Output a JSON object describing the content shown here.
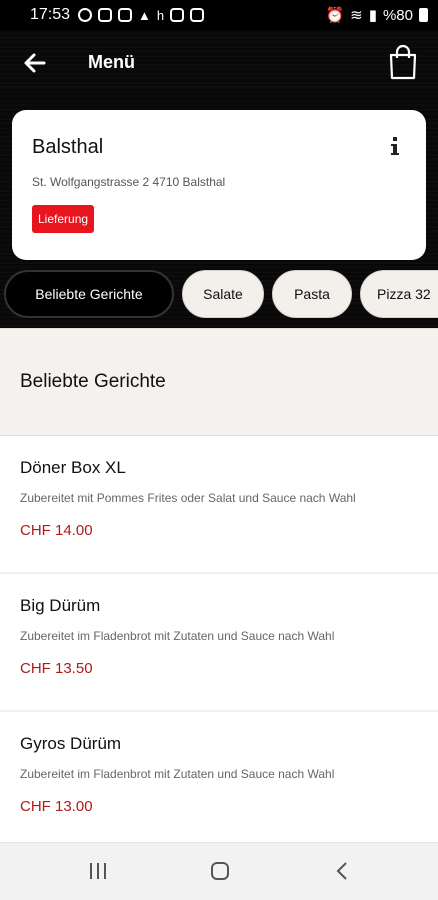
{
  "status_bar": {
    "time": "17:53",
    "left_icons": [
      "whatsapp-icon",
      "instagram-icon",
      "package-icon",
      "ship-icon",
      "h-icon",
      "instagram-icon",
      "image-icon"
    ],
    "h_label": "h",
    "battery": "%80"
  },
  "header": {
    "title": "Menü"
  },
  "location": {
    "name": "Balsthal",
    "address": "St. Wolfgangstrasse 2 4710 Balsthal",
    "badge": "Lieferung"
  },
  "categories": [
    {
      "label": "Beliebte Gerichte",
      "active": true
    },
    {
      "label": "Salate",
      "active": false
    },
    {
      "label": "Pasta",
      "active": false
    },
    {
      "label": "Pizza 32",
      "active": false
    }
  ],
  "section": {
    "title": "Beliebte Gerichte"
  },
  "items": [
    {
      "name": "Döner Box XL",
      "description": "Zubereitet mit Pommes Frites oder Salat und Sauce nach Wahl",
      "price": "CHF 14.00"
    },
    {
      "name": "Big Dürüm",
      "description": "Zubereitet im Fladenbrot mit Zutaten und Sauce nach Wahl",
      "price": "CHF 13.50"
    },
    {
      "name": "Gyros Dürüm",
      "description": "Zubereitet im Fladenbrot mit Zutaten und Sauce nach Wahl",
      "price": "CHF 13.00"
    }
  ],
  "colors": {
    "accent_red": "#e8141e",
    "price_red": "#b01a1a",
    "header_bg": "#000000"
  }
}
